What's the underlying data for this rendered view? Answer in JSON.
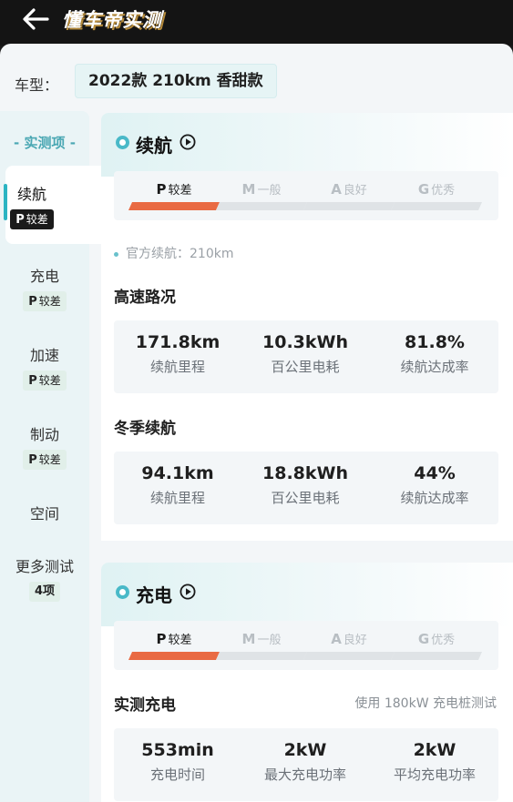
{
  "header": {
    "title": "懂车帝实测"
  },
  "model": {
    "label": "车型：",
    "value": "2022款 210km 香甜款"
  },
  "sidebar": {
    "heading": "- 实测项 -",
    "items": [
      {
        "label": "续航",
        "grade": "P",
        "grade_text": "较差"
      },
      {
        "label": "充电",
        "grade": "P",
        "grade_text": "较差"
      },
      {
        "label": "加速",
        "grade": "P",
        "grade_text": "较差"
      },
      {
        "label": "制动",
        "grade": "P",
        "grade_text": "较差"
      },
      {
        "label": "空间"
      },
      {
        "label": "更多测试",
        "badge": "4项"
      }
    ]
  },
  "rating_scale": [
    {
      "grade": "P",
      "text": "较差"
    },
    {
      "grade": "M",
      "text": "一般"
    },
    {
      "grade": "A",
      "text": "良好"
    },
    {
      "grade": "G",
      "text": "优秀"
    }
  ],
  "range": {
    "title": "续航",
    "selected_level": 0,
    "official": "官方续航：210km",
    "highway": {
      "title": "高速路况",
      "stats": [
        {
          "value": "171.8km",
          "label": "续航里程"
        },
        {
          "value": "10.3kWh",
          "label": "百公里电耗"
        },
        {
          "value": "81.8%",
          "label": "续航达成率"
        }
      ]
    },
    "winter": {
      "title": "冬季续航",
      "stats": [
        {
          "value": "94.1km",
          "label": "续航里程"
        },
        {
          "value": "18.8kWh",
          "label": "百公里电耗"
        },
        {
          "value": "44%",
          "label": "续航达成率"
        }
      ]
    }
  },
  "charging": {
    "title": "充电",
    "selected_level": 0,
    "measured": {
      "title": "实测充电",
      "note": "使用 180kW 充电桩测试",
      "stats": [
        {
          "value": "553min",
          "label": "充电时间"
        },
        {
          "value": "2kW",
          "label": "最大充电功率"
        },
        {
          "value": "2kW",
          "label": "平均充电功率"
        }
      ]
    }
  },
  "colors": {
    "accent": "#49b9c8",
    "poor": "#e96a43",
    "brand_shadow": "#b58a3a"
  },
  "icons": {
    "back": "arrow-left-icon",
    "play": "play-circle-icon"
  }
}
